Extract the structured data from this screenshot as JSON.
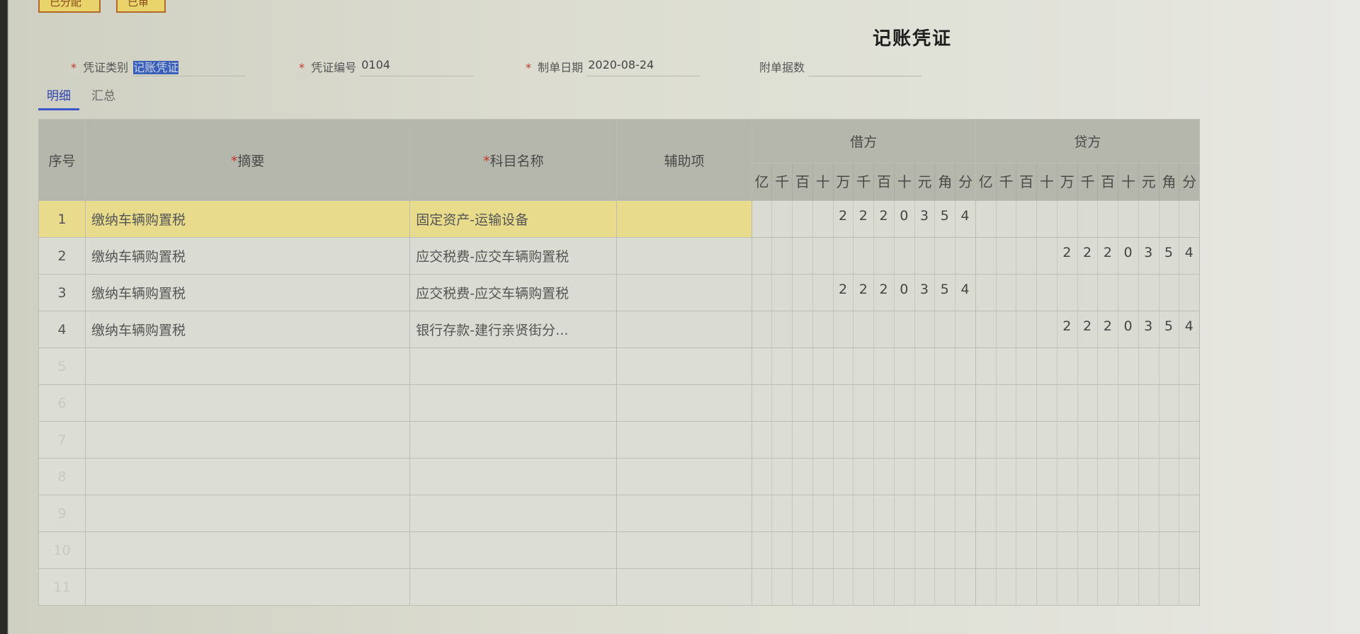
{
  "toolbar": {
    "assigned_label": "已分配",
    "audited_label": "已审"
  },
  "voucher": {
    "title": "记账凭证",
    "type_label": "凭证类别",
    "type_value": "记账凭证",
    "number_label": "凭证编号",
    "number_value": "0104",
    "date_label": "制单日期",
    "date_value": "2020-08-24",
    "attach_label": "附单据数",
    "attach_value": ""
  },
  "tabs": [
    {
      "label": "明细"
    },
    {
      "label": "汇总"
    }
  ],
  "table": {
    "headers": {
      "index": "序号",
      "summary": "摘要",
      "account": "科目名称",
      "aux": "辅助项",
      "debit": "借方",
      "credit": "贷方"
    },
    "units": [
      "亿",
      "千",
      "百",
      "十",
      "万",
      "千",
      "百",
      "十",
      "元",
      "角",
      "分"
    ],
    "rows": [
      {
        "index": "1",
        "summary": "缴纳车辆购置税",
        "account": "固定资产-运输设备",
        "aux": "",
        "debit": "2220354",
        "credit": ""
      },
      {
        "index": "2",
        "summary": "缴纳车辆购置税",
        "account": "应交税费-应交车辆购置税",
        "aux": "",
        "debit": "",
        "credit": "2220354"
      },
      {
        "index": "3",
        "summary": "缴纳车辆购置税",
        "account": "应交税费-应交车辆购置税",
        "aux": "",
        "debit": "2220354",
        "credit": ""
      },
      {
        "index": "4",
        "summary": "缴纳车辆购置税",
        "account": "银行存款-建行亲贤街分...",
        "aux": "",
        "debit": "",
        "credit": "2220354"
      }
    ],
    "empty_rows": [
      "5",
      "6",
      "7",
      "8",
      "9",
      "10",
      "11"
    ]
  }
}
